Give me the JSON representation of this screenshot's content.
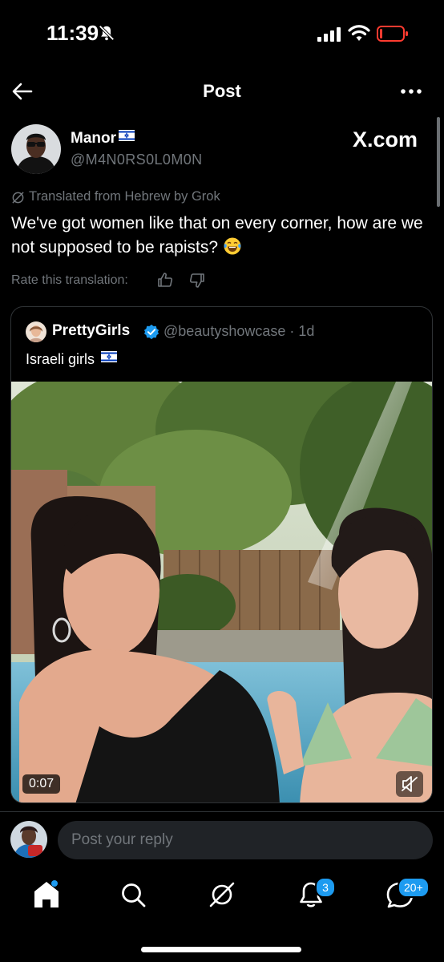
{
  "status_bar": {
    "time": "11:39",
    "icons": [
      "bell-slash-icon",
      "cellular-signal-icon",
      "wifi-icon",
      "battery-icon"
    ],
    "battery_color": "#ff3b30"
  },
  "header": {
    "title": "Post",
    "back_icon": "arrow-left-icon",
    "more_icon": "more-horizontal-icon"
  },
  "post": {
    "author": {
      "name": "Manor",
      "handle": "@M4N0RS0L0M0N",
      "name_flag": "israel-flag"
    },
    "source_label": "X.com",
    "translation_note": "Translated from Hebrew by Grok",
    "text": "We've got women like that on every corner, how are we not supposed to be rapists?",
    "text_emoji": "face-with-tears-of-joy",
    "rate_label": "Rate this translation:"
  },
  "quoted_post": {
    "name": "PrettyGirls",
    "verified": true,
    "handle_time": "@beautyshowcase · 1d",
    "text": "Israeli girls",
    "text_flag": "israel-flag",
    "video_duration": "0:07"
  },
  "reply": {
    "placeholder": "Post your reply"
  },
  "bottom_nav": {
    "items": [
      "home-icon",
      "search-icon",
      "grok-icon",
      "notifications-icon",
      "messages-icon"
    ],
    "notifications_badge": "3",
    "messages_badge": "20+"
  },
  "colors": {
    "accent": "#1d9bf0",
    "background": "#000000",
    "secondary_text": "#71767b",
    "border": "#2f3336"
  }
}
